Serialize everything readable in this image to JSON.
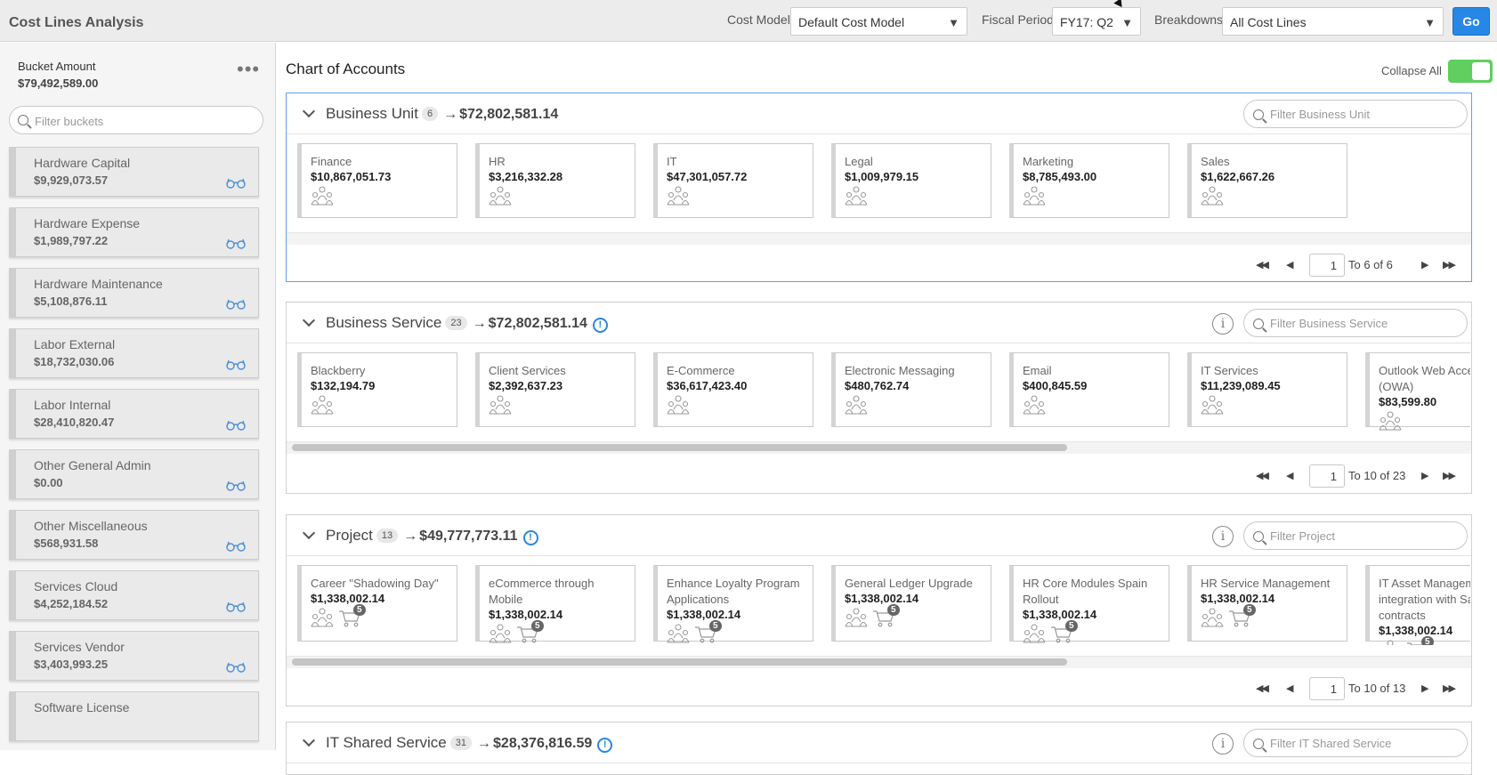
{
  "header": {
    "title": "Cost Lines Analysis",
    "cost_model_label": "Cost Model",
    "cost_model_value": "Default Cost Model",
    "fiscal_period_label": "Fiscal Period",
    "fiscal_period_value": "FY17: Q2",
    "breakdowns_label": "Breakdowns",
    "breakdowns_value": "All Cost Lines",
    "go_label": "Go"
  },
  "sidebar": {
    "bucket_label": "Bucket Amount",
    "bucket_amount": "$79,492,589.00",
    "filter_placeholder": "Filter buckets",
    "buckets": [
      {
        "name": "Hardware Capital",
        "amount": "$9,929,073.57"
      },
      {
        "name": "Hardware Expense",
        "amount": "$1,989,797.22"
      },
      {
        "name": "Hardware Maintenance",
        "amount": "$5,108,876.11"
      },
      {
        "name": "Labor External",
        "amount": "$18,732,030.06"
      },
      {
        "name": "Labor Internal",
        "amount": "$28,410,820.47"
      },
      {
        "name": "Other General Admin",
        "amount": "$0.00"
      },
      {
        "name": "Other Miscellaneous",
        "amount": "$568,931.58"
      },
      {
        "name": "Services Cloud",
        "amount": "$4,252,184.52"
      },
      {
        "name": "Services Vendor",
        "amount": "$3,403,993.25"
      },
      {
        "name": "Software License",
        "amount": ""
      }
    ]
  },
  "main": {
    "title": "Chart of Accounts",
    "collapse_all_label": "Collapse All",
    "collapse_all_on": true,
    "sections": [
      {
        "title": "Business Unit",
        "count": "6",
        "arrow": "→",
        "total": "$72,802,581.14",
        "filter_placeholder": "Filter Business Unit",
        "page": "1",
        "page_text": "To 6  of 6",
        "cards": [
          {
            "name": "Finance",
            "amount": "$10,867,051.73"
          },
          {
            "name": "HR",
            "amount": "$3,216,332.28"
          },
          {
            "name": "IT",
            "amount": "$47,301,057.72"
          },
          {
            "name": "Legal",
            "amount": "$1,009,979.15"
          },
          {
            "name": "Marketing",
            "amount": "$8,785,493.00"
          },
          {
            "name": "Sales",
            "amount": "$1,622,667.26"
          }
        ]
      },
      {
        "title": "Business Service",
        "count": "23",
        "arrow": "→",
        "total": "$72,802,581.14",
        "warn": "!",
        "info": "i",
        "filter_placeholder": "Filter Business Service",
        "page": "1",
        "page_text": "To 10  of 23",
        "cards": [
          {
            "name": "Blackberry",
            "amount": "$132,194.79"
          },
          {
            "name": "Client Services",
            "amount": "$2,392,637.23"
          },
          {
            "name": "E-Commerce",
            "amount": "$36,617,423.40"
          },
          {
            "name": "Electronic Messaging",
            "amount": "$480,762.74"
          },
          {
            "name": "Email",
            "amount": "$400,845.59"
          },
          {
            "name": "IT Services",
            "amount": "$11,239,089.45"
          },
          {
            "name": "Outlook Web Access (OWA)",
            "amount": "$83,599.80"
          }
        ]
      },
      {
        "title": "Project",
        "count": "13",
        "arrow": "→",
        "total": "$49,777,773.11",
        "warn": "!",
        "info": "i",
        "filter_placeholder": "Filter Project",
        "page": "1",
        "page_text": "To 10  of 13",
        "cards": [
          {
            "name": "Career \"Shadowing Day\"",
            "amount": "$1,338,002.14",
            "badge": "5"
          },
          {
            "name": "eCommerce through Mobile",
            "amount": "$1,338,002.14",
            "badge": "5"
          },
          {
            "name": "Enhance Loyalty Program Applications",
            "amount": "$1,338,002.14",
            "badge": "5"
          },
          {
            "name": "General Ledger Upgrade",
            "amount": "$1,338,002.14",
            "badge": "5"
          },
          {
            "name": "HR Core Modules Spain Rollout",
            "amount": "$1,338,002.14",
            "badge": "5"
          },
          {
            "name": "HR Service Management",
            "amount": "$1,338,002.14",
            "badge": "5"
          },
          {
            "name": "IT Asset Management integration with Sales contracts",
            "amount": "$1,338,002.14",
            "badge": "5"
          }
        ]
      },
      {
        "title": "IT Shared Service",
        "count": "31",
        "arrow": "→",
        "total": "$28,376,816.59",
        "warn": "!",
        "info": "i",
        "filter_placeholder": "Filter IT Shared Service"
      }
    ]
  },
  "colors": {
    "accent": "#2787e6",
    "toggle_on": "#5fcf5f",
    "active_border": "#5aa4e8"
  }
}
